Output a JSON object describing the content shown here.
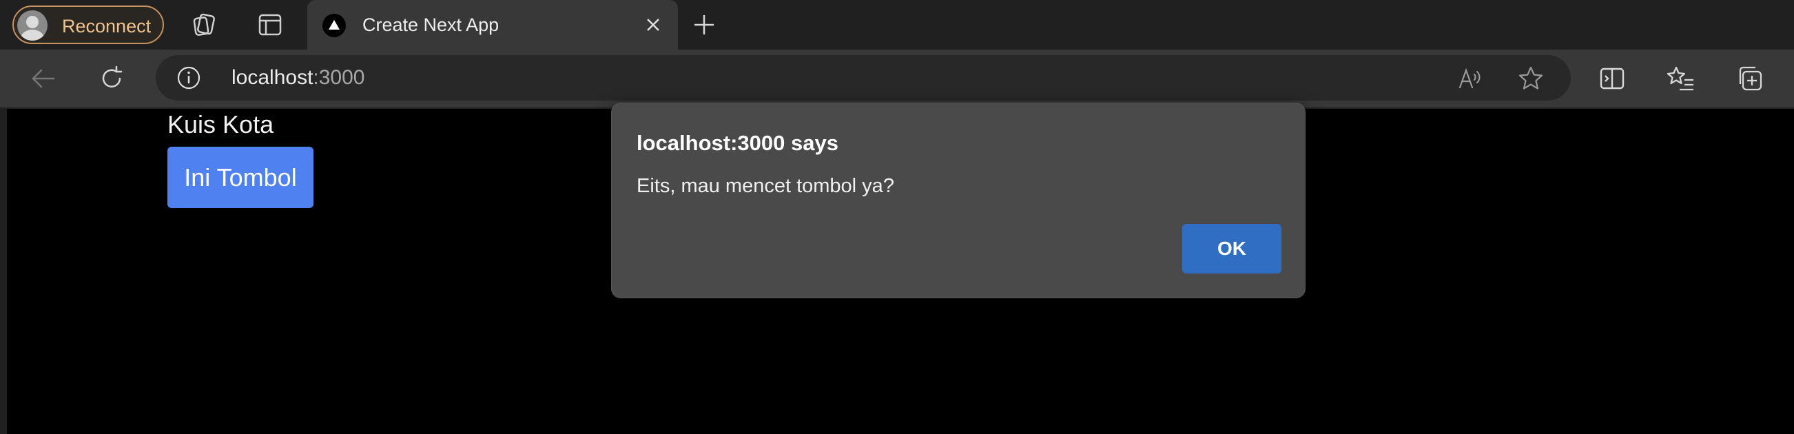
{
  "tabstrip": {
    "profile_label": "Reconnect",
    "active_tab_title": "Create Next App"
  },
  "address_bar": {
    "url_host": "localhost",
    "url_port": ":3000"
  },
  "page": {
    "title": "Kuis Kota",
    "button_label": "Ini Tombol"
  },
  "dialog": {
    "title": "localhost:3000 says",
    "message": "Eits, mau mencet tombol ya?",
    "ok_label": "OK"
  },
  "colors": {
    "chrome_dark": "#202020",
    "toolbar": "#383838",
    "page_background": "#000000",
    "page_button": "#4f82f0",
    "dialog_background": "#4a4a4a",
    "dialog_ok": "#2f6ec2",
    "reconnect_accent": "#c8925e"
  }
}
